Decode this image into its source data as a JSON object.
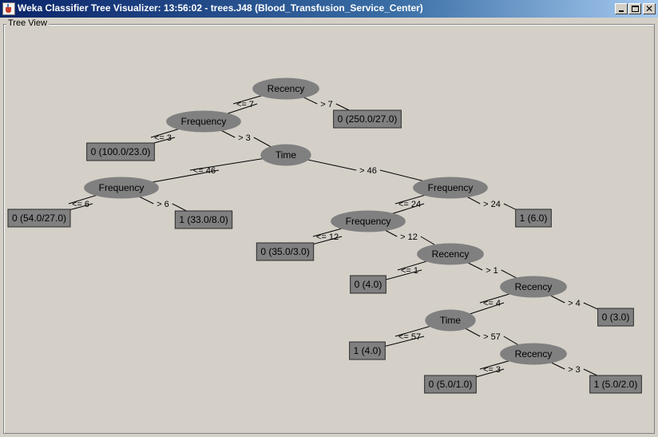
{
  "window": {
    "title": "Weka Classifier Tree Visualizer: 13:56:02 - trees.J48 (Blood_Transfusion_Service_Center)",
    "close_glyph": "✕"
  },
  "panel": {
    "title": "Tree View"
  },
  "tree": {
    "nodes": [
      {
        "id": "n1",
        "kind": "split",
        "label": "Recency"
      },
      {
        "id": "n2",
        "kind": "split",
        "label": "Frequency"
      },
      {
        "id": "n3",
        "kind": "leaf",
        "label": "0 (250.0/27.0)"
      },
      {
        "id": "n4",
        "kind": "leaf",
        "label": "0 (100.0/23.0)"
      },
      {
        "id": "n5",
        "kind": "split",
        "label": "Time"
      },
      {
        "id": "n6",
        "kind": "split",
        "label": "Frequency"
      },
      {
        "id": "n7",
        "kind": "split",
        "label": "Frequency"
      },
      {
        "id": "n8",
        "kind": "leaf",
        "label": "0 (54.0/27.0)"
      },
      {
        "id": "n9",
        "kind": "leaf",
        "label": "1 (33.0/8.0)"
      },
      {
        "id": "n10",
        "kind": "split",
        "label": "Frequency"
      },
      {
        "id": "n11",
        "kind": "leaf",
        "label": "1 (6.0)"
      },
      {
        "id": "n12",
        "kind": "leaf",
        "label": "0 (35.0/3.0)"
      },
      {
        "id": "n13",
        "kind": "split",
        "label": "Recency"
      },
      {
        "id": "n14",
        "kind": "leaf",
        "label": "0 (4.0)"
      },
      {
        "id": "n15",
        "kind": "split",
        "label": "Recency"
      },
      {
        "id": "n16",
        "kind": "split",
        "label": "Time"
      },
      {
        "id": "n17",
        "kind": "leaf",
        "label": "0 (3.0)"
      },
      {
        "id": "n18",
        "kind": "leaf",
        "label": "1 (4.0)"
      },
      {
        "id": "n19",
        "kind": "split",
        "label": "Recency"
      },
      {
        "id": "n20",
        "kind": "leaf",
        "label": "0 (5.0/1.0)"
      },
      {
        "id": "n21",
        "kind": "leaf",
        "label": "1 (5.0/2.0)"
      }
    ],
    "edges": [
      {
        "from": "n1",
        "to": "n2",
        "label": "<= 7"
      },
      {
        "from": "n1",
        "to": "n3",
        "label": "> 7"
      },
      {
        "from": "n2",
        "to": "n4",
        "label": "<= 3"
      },
      {
        "from": "n2",
        "to": "n5",
        "label": "> 3"
      },
      {
        "from": "n5",
        "to": "n6",
        "label": "<= 46"
      },
      {
        "from": "n5",
        "to": "n7",
        "label": "> 46"
      },
      {
        "from": "n6",
        "to": "n8",
        "label": "<= 6"
      },
      {
        "from": "n6",
        "to": "n9",
        "label": "> 6"
      },
      {
        "from": "n7",
        "to": "n10",
        "label": "<= 24"
      },
      {
        "from": "n7",
        "to": "n11",
        "label": "> 24"
      },
      {
        "from": "n10",
        "to": "n12",
        "label": "<= 12"
      },
      {
        "from": "n10",
        "to": "n13",
        "label": "> 12"
      },
      {
        "from": "n13",
        "to": "n14",
        "label": "<= 1"
      },
      {
        "from": "n13",
        "to": "n15",
        "label": "> 1"
      },
      {
        "from": "n15",
        "to": "n16",
        "label": "<= 4"
      },
      {
        "from": "n15",
        "to": "n17",
        "label": "> 4"
      },
      {
        "from": "n16",
        "to": "n18",
        "label": "<= 57"
      },
      {
        "from": "n16",
        "to": "n19",
        "label": "> 57"
      },
      {
        "from": "n19",
        "to": "n20",
        "label": "<= 3"
      },
      {
        "from": "n19",
        "to": "n21",
        "label": "> 3"
      }
    ]
  },
  "colors": {
    "node_fill": "#808080",
    "node_text": "#000000",
    "edge": "#000000",
    "background": "#d4d0c8"
  }
}
